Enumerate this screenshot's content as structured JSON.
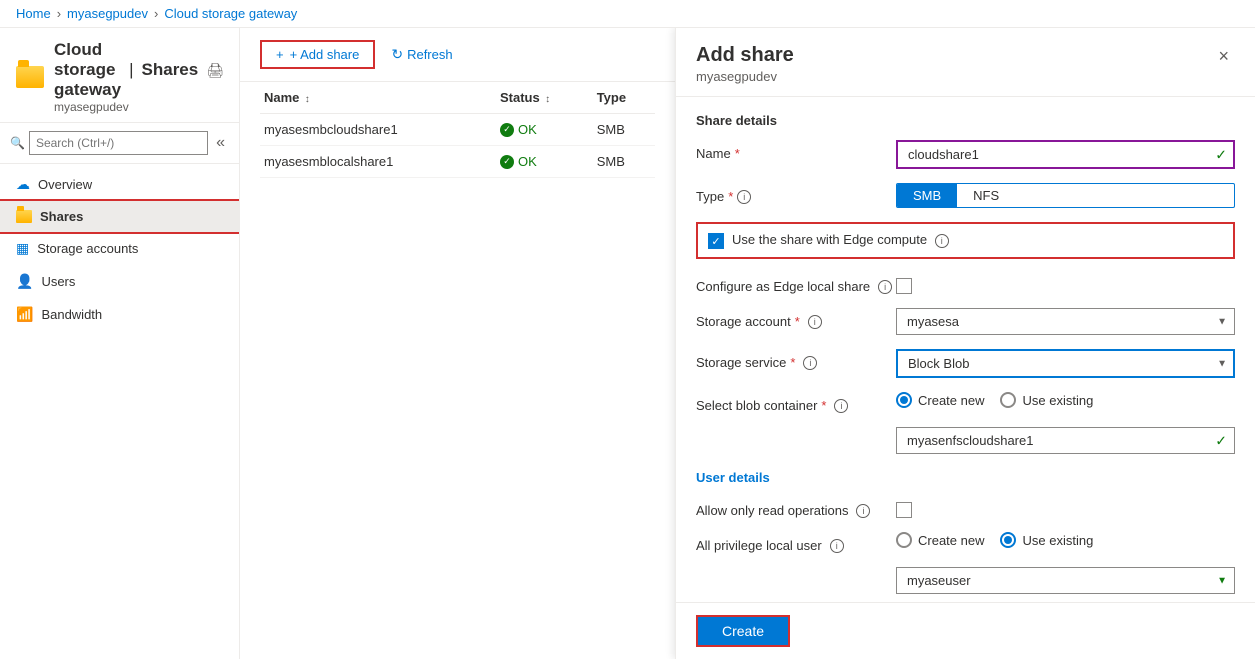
{
  "breadcrumb": {
    "home": "Home",
    "device": "myasegpudev",
    "page": "Cloud storage gateway"
  },
  "resource": {
    "title": "Cloud storage gateway",
    "separator": "|",
    "section": "Shares",
    "subtitle": "myasegpudev"
  },
  "search": {
    "placeholder": "Search (Ctrl+/)"
  },
  "toolbar": {
    "add_share": "+ Add share",
    "refresh": "Refresh"
  },
  "nav": {
    "items": [
      {
        "id": "overview",
        "label": "Overview",
        "icon": "cloud"
      },
      {
        "id": "shares",
        "label": "Shares",
        "icon": "folder",
        "active": true
      },
      {
        "id": "storage-accounts",
        "label": "Storage accounts",
        "icon": "storage"
      },
      {
        "id": "users",
        "label": "Users",
        "icon": "user"
      },
      {
        "id": "bandwidth",
        "label": "Bandwidth",
        "icon": "bandwidth"
      }
    ]
  },
  "table": {
    "columns": [
      {
        "label": "Name",
        "sortable": true
      },
      {
        "label": "Status",
        "sortable": true
      },
      {
        "label": "Type",
        "sortable": false
      }
    ],
    "rows": [
      {
        "name": "myasesmbcloudshare1",
        "status": "OK",
        "type": "SMB"
      },
      {
        "name": "myasesmblocalshare1",
        "status": "OK",
        "type": "SMB"
      }
    ]
  },
  "panel": {
    "title": "Add share",
    "subtitle": "myasegpudev",
    "close_label": "×",
    "sections": {
      "share_details": "Share details",
      "user_details": "User details"
    },
    "fields": {
      "name_label": "Name",
      "name_required": "*",
      "name_value": "cloudshare1",
      "type_label": "Type",
      "type_required": "*",
      "type_smb": "SMB",
      "type_nfs": "NFS",
      "edge_compute_label": "Use the share with Edge compute",
      "edge_compute_info": "ℹ",
      "edge_local_label": "Configure as Edge local share",
      "edge_local_info": "ℹ",
      "storage_account_label": "Storage account",
      "storage_account_required": "*",
      "storage_account_info": "ℹ",
      "storage_account_value": "myasesa",
      "storage_service_label": "Storage service",
      "storage_service_required": "*",
      "storage_service_info": "ℹ",
      "storage_service_value": "Block Blob",
      "blob_container_label": "Select blob container",
      "blob_container_required": "*",
      "blob_container_info": "ℹ",
      "blob_create_new": "Create new",
      "blob_use_existing": "Use existing",
      "blob_container_value": "myasenfscloudshare1",
      "allow_read_label": "Allow only read operations",
      "allow_read_info": "ℹ",
      "all_privilege_label": "All privilege local user",
      "all_privilege_info": "ℹ",
      "privilege_create_new": "Create new",
      "privilege_use_existing": "Use existing",
      "user_value": "myaseuser"
    },
    "create_btn": "Create"
  }
}
